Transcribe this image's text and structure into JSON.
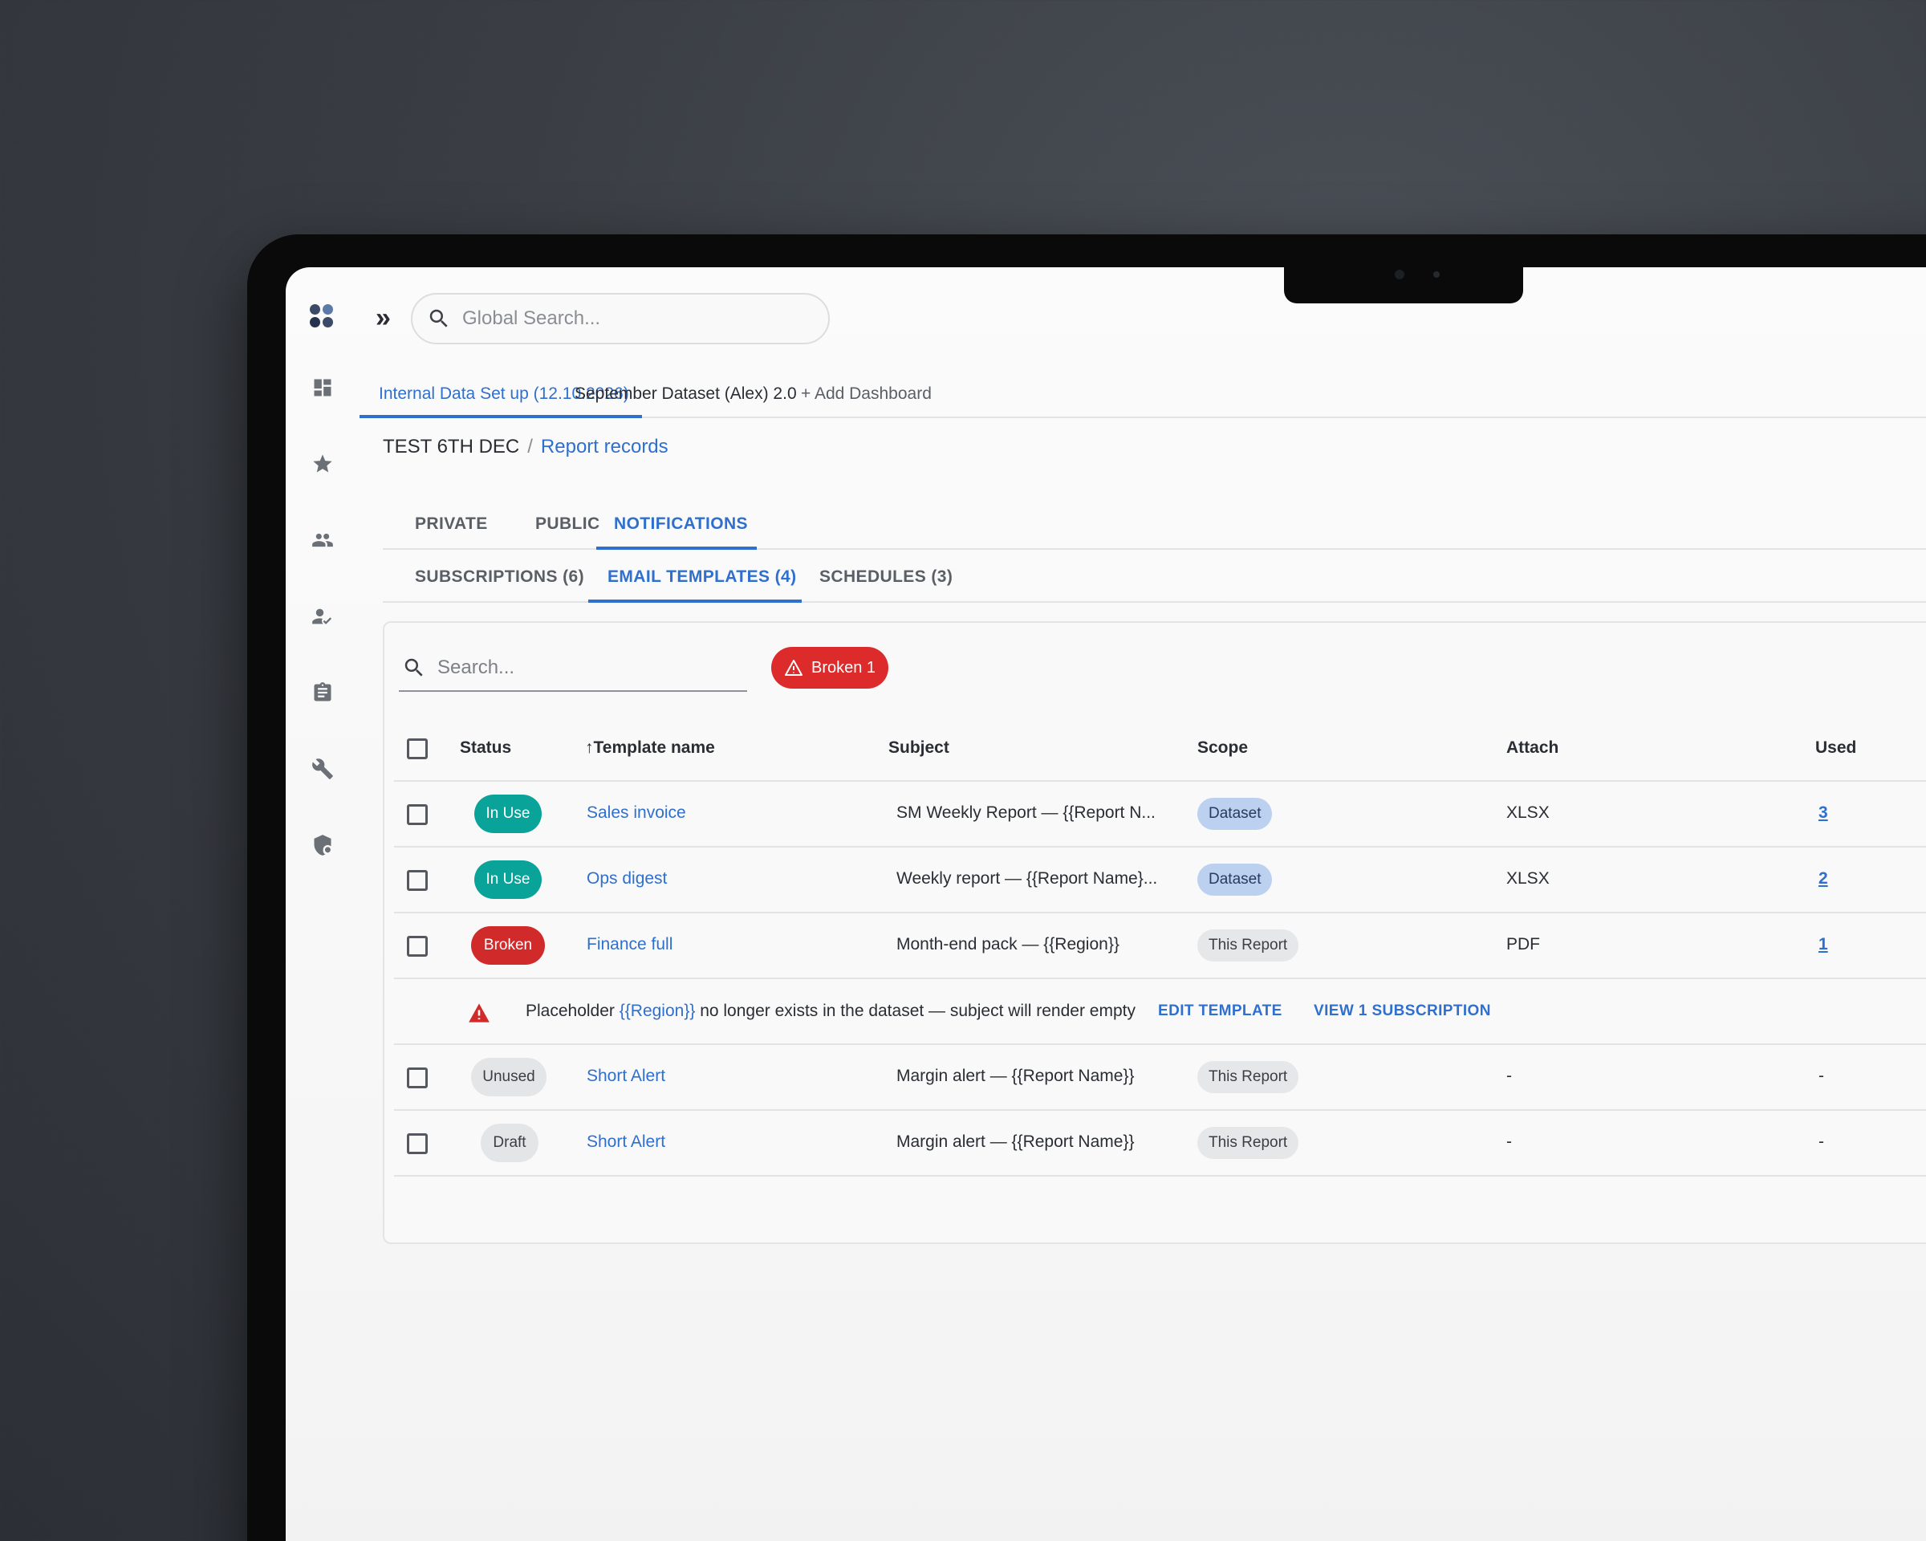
{
  "search": {
    "global_placeholder": "Global Search...",
    "table_placeholder": "Search..."
  },
  "dashboard_tabs": [
    {
      "label": "Internal Data Set up (12.10.2026)"
    },
    {
      "label": "September Dataset (Alex) 2.0"
    },
    {
      "label": "+ Add Dashboard"
    }
  ],
  "breadcrumb": {
    "root": "TEST 6TH DEC",
    "separator": "/",
    "current": "Report records"
  },
  "section_tabs": [
    {
      "label": "PRIVATE"
    },
    {
      "label": "PUBLIC"
    },
    {
      "label": "NOTIFICATIONS"
    }
  ],
  "sub_tabs": [
    {
      "label": "SUBSCRIPTIONS (6)"
    },
    {
      "label": "EMAIL TEMPLATES (4)"
    },
    {
      "label": "SCHEDULES (3)"
    }
  ],
  "filter_chip": {
    "label": "Broken 1"
  },
  "table": {
    "headers": {
      "status": "Status",
      "template_name": "Template name",
      "subject": "Subject",
      "scope": "Scope",
      "attach": "Attach",
      "used": "Used"
    },
    "rows": [
      {
        "status": "In Use",
        "name": "Sales invoice",
        "subject": "SM Weekly Report — {{Report N...",
        "scope": "Dataset",
        "attach": "XLSX",
        "used": "3"
      },
      {
        "status": "In Use",
        "name": "Ops digest",
        "subject": "Weekly report — {{Report Name}...",
        "scope": "Dataset",
        "attach": "XLSX",
        "used": "2"
      },
      {
        "status": "Broken",
        "name": "Finance full",
        "subject": "Month-end pack — {{Region}}",
        "scope": "This Report",
        "attach": "PDF",
        "used": "1"
      },
      {
        "status": "Unused",
        "name": "Short Alert",
        "subject": "Margin alert — {{Report Name}}",
        "scope": "This Report",
        "attach": "-",
        "used": "-"
      },
      {
        "status": "Draft",
        "name": "Short Alert",
        "subject": "Margin alert — {{Report Name}}",
        "scope": "This Report",
        "attach": "-",
        "used": "-"
      }
    ],
    "alert": {
      "prefix": "Placeholder",
      "placeholder": "{{Region}}",
      "suffix": "no longer exists in the dataset — subject will render empty",
      "edit_action": "EDIT TEMPLATE",
      "view_action": "VIEW 1 SUBSCRIPTION"
    }
  },
  "colors": {
    "accent": "#2f6fce",
    "in_use": "#0aa39a",
    "broken": "#d12a2a",
    "dataset_scope": "#bcd0ef"
  },
  "icons": [
    "app-logo-icon",
    "expand-icon",
    "search-icon",
    "dashboard-icon",
    "star-icon",
    "group-icon",
    "user-check-icon",
    "clipboard-icon",
    "wrench-icon",
    "security-icon",
    "sort-up-icon",
    "warning-icon"
  ]
}
